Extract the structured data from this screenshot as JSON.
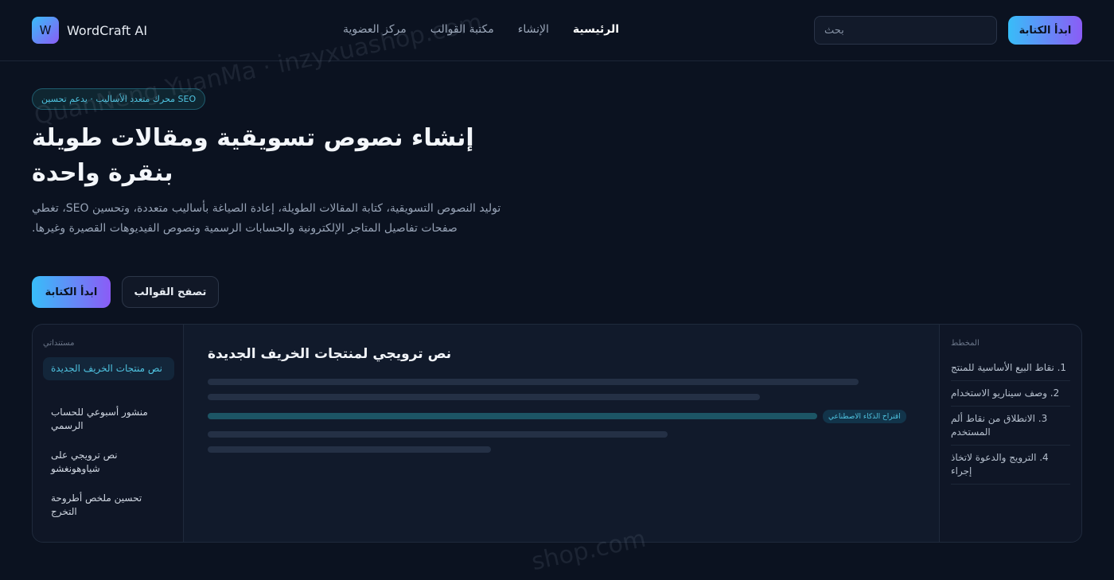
{
  "brand": {
    "logo_letter": "W",
    "name": "WordCraft AI"
  },
  "nav": {
    "items": [
      "الرئيسية",
      "الإنشاء",
      "مكتبة القوالب",
      "مركز العضوية"
    ],
    "active_index": 0
  },
  "search": {
    "placeholder": "بحث"
  },
  "header": {
    "cta_label": "ابدأ الكتابة"
  },
  "hero": {
    "badge": "محرك متعدد الأساليب · يدعم تحسين SEO",
    "title": "إنشاء نصوص تسويقية ومقالات طويلة بنقرة واحدة",
    "description": "توليد النصوص التسويقية، كتابة المقالات الطويلة، إعادة الصياغة بأساليب متعددة، وتحسين SEO، تغطي صفحات تفاصيل المتاجر الإلكترونية والحسابات الرسمية ونصوص الفيديوهات القصيرة وغيرها.",
    "start_label": "ابدأ الكتابة",
    "browse_label": "تصفح القوالب"
  },
  "docs": {
    "title": "مستنداتي",
    "items": [
      "نص منتجات الخريف الجديدة",
      "منشور أسبوعي للحساب الرسمي",
      "نص ترويجي على شياوهونغشو",
      "تحسين ملخص أطروحة التخرج"
    ],
    "active_index": 0
  },
  "editor": {
    "heading": "نص ترويجي لمنتجات الخريف الجديدة",
    "ai_tag": "اقتراح الذكاء الاصطناعي"
  },
  "outline": {
    "title": "المخطط",
    "items": [
      "1. نقاط البيع الأساسية للمنتج",
      "2. وصف سيناريو الاستخدام",
      "3. الانطلاق من نقاط ألم المستخدم",
      "4. الترويج والدعوة لاتخاذ إجراء"
    ]
  },
  "watermark": {
    "top": "QuanNeng YuanMa · inzyxuashop.com",
    "bottom": "shop.com"
  },
  "colors": {
    "accent_start": "#38bdf8",
    "accent_end": "#8b5cf6",
    "background": "#0b1220"
  }
}
